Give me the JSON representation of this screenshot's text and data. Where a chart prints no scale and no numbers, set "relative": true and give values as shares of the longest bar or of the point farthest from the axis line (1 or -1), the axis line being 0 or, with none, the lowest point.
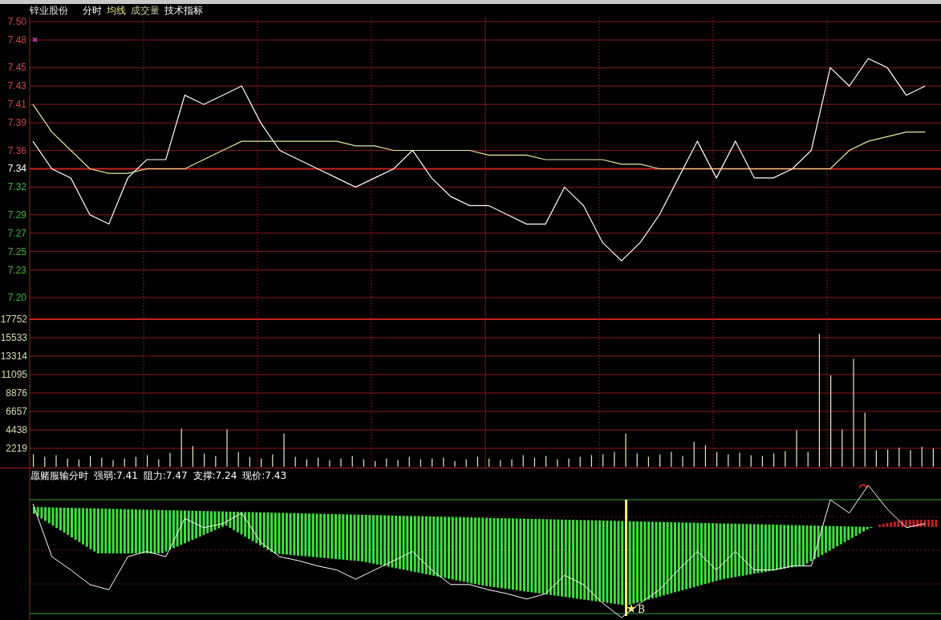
{
  "header": {
    "stock_name": "锌业股份",
    "menu": [
      {
        "label": "分时",
        "kind": "plain"
      },
      {
        "label": "均线",
        "kind": "average"
      },
      {
        "label": "成交量",
        "kind": "volume"
      },
      {
        "label": "技术指标",
        "kind": "plain"
      }
    ]
  },
  "price_chart": {
    "chart_data": {
      "type": "line",
      "ylim": [
        7.2,
        7.5
      ],
      "grid": true,
      "yticks": [
        {
          "value": 7.5,
          "label": "7.50"
        },
        {
          "value": 7.48,
          "label": "7.48"
        },
        {
          "value": 7.45,
          "label": "7.45"
        },
        {
          "value": 7.43,
          "label": "7.43"
        },
        {
          "value": 7.41,
          "label": "7.41"
        },
        {
          "value": 7.39,
          "label": "7.39"
        },
        {
          "value": 7.36,
          "label": "7.36"
        },
        {
          "value": 7.34,
          "label": "7.34"
        },
        {
          "value": 7.32,
          "label": "7.32"
        },
        {
          "value": 7.29,
          "label": "7.29"
        },
        {
          "value": 7.27,
          "label": "7.27"
        },
        {
          "value": 7.25,
          "label": "7.25"
        },
        {
          "value": 7.23,
          "label": "7.23"
        },
        {
          "value": 7.2,
          "label": "7.20"
        }
      ],
      "series": [
        {
          "color": "#ffffff",
          "values": [
            7.37,
            7.34,
            7.33,
            7.29,
            7.28,
            7.33,
            7.35,
            7.35,
            7.42,
            7.41,
            7.42,
            7.43,
            7.39,
            7.36,
            7.35,
            7.34,
            7.33,
            7.32,
            7.33,
            7.34,
            7.36,
            7.33,
            7.31,
            7.3,
            7.3,
            7.29,
            7.28,
            7.28,
            7.32,
            7.3,
            7.26,
            7.24,
            7.26,
            7.29,
            7.33,
            7.37,
            7.33,
            7.37,
            7.33,
            7.33,
            7.34,
            7.36,
            7.45,
            7.43,
            7.46,
            7.45,
            7.42,
            7.43
          ]
        },
        {
          "color": "#e8e8a0",
          "values": [
            7.41,
            7.38,
            7.36,
            7.34,
            7.335,
            7.335,
            7.34,
            7.34,
            7.34,
            7.35,
            7.36,
            7.37,
            7.37,
            7.37,
            7.37,
            7.37,
            7.37,
            7.365,
            7.365,
            7.36,
            7.36,
            7.36,
            7.36,
            7.36,
            7.355,
            7.355,
            7.355,
            7.35,
            7.35,
            7.35,
            7.35,
            7.345,
            7.345,
            7.34,
            7.34,
            7.34,
            7.34,
            7.34,
            7.34,
            7.34,
            7.34,
            7.34,
            7.34,
            7.36,
            7.37,
            7.375,
            7.38,
            7.38
          ]
        }
      ]
    }
  },
  "volume_chart": {
    "chart_data": {
      "type": "bar",
      "ylim": [
        0,
        17752
      ],
      "grid": true,
      "yticks": [
        2219,
        4438,
        6657,
        8876,
        11095,
        13314,
        15533,
        17752
      ],
      "values": [
        1500,
        1200,
        1400,
        1000,
        900,
        1300,
        1100,
        800,
        1000,
        1200,
        1400,
        900,
        1700,
        4600,
        2500,
        1600,
        1300,
        4500,
        1800,
        1200,
        1000,
        1500,
        4000,
        1200,
        900,
        1100,
        800,
        1000,
        1300,
        900,
        700,
        1000,
        800,
        1200,
        900,
        1000,
        1100,
        700,
        900,
        1200,
        1000,
        800,
        900,
        1400,
        1100,
        1300,
        900,
        1000,
        1200,
        1400,
        1500,
        1800,
        4000,
        1600,
        1200,
        1500,
        1800,
        1300,
        3000,
        2600,
        1800,
        1500,
        1700,
        1400,
        1300,
        1600,
        1900,
        4400,
        1800,
        16000,
        11000,
        4500,
        13000,
        6500,
        2000,
        2100,
        2300,
        2000,
        2400,
        2200
      ]
    }
  },
  "indicator": {
    "name": "愿赌服输分时",
    "readings": [
      {
        "label": "强弱:7.41"
      },
      {
        "label": "阻力:7.47"
      },
      {
        "label": "支撑:7.24"
      },
      {
        "label": "现价:7.43"
      }
    ],
    "signal_label": "B",
    "chart_data": {
      "type": "line",
      "relative": true,
      "series": [
        {
          "color": "#ffffff",
          "values": [
            0.86,
            0.46,
            0.36,
            0.25,
            0.21,
            0.46,
            0.5,
            0.46,
            0.75,
            0.68,
            0.71,
            0.79,
            0.57,
            0.46,
            0.43,
            0.39,
            0.36,
            0.29,
            0.36,
            0.43,
            0.5,
            0.36,
            0.25,
            0.25,
            0.21,
            0.18,
            0.14,
            0.18,
            0.32,
            0.25,
            0.11,
            0,
            0.11,
            0.21,
            0.36,
            0.5,
            0.36,
            0.5,
            0.36,
            0.36,
            0.39,
            0.39,
            0.89,
            0.79,
            1,
            0.82,
            0.68,
            0.71
          ]
        }
      ]
    }
  }
}
